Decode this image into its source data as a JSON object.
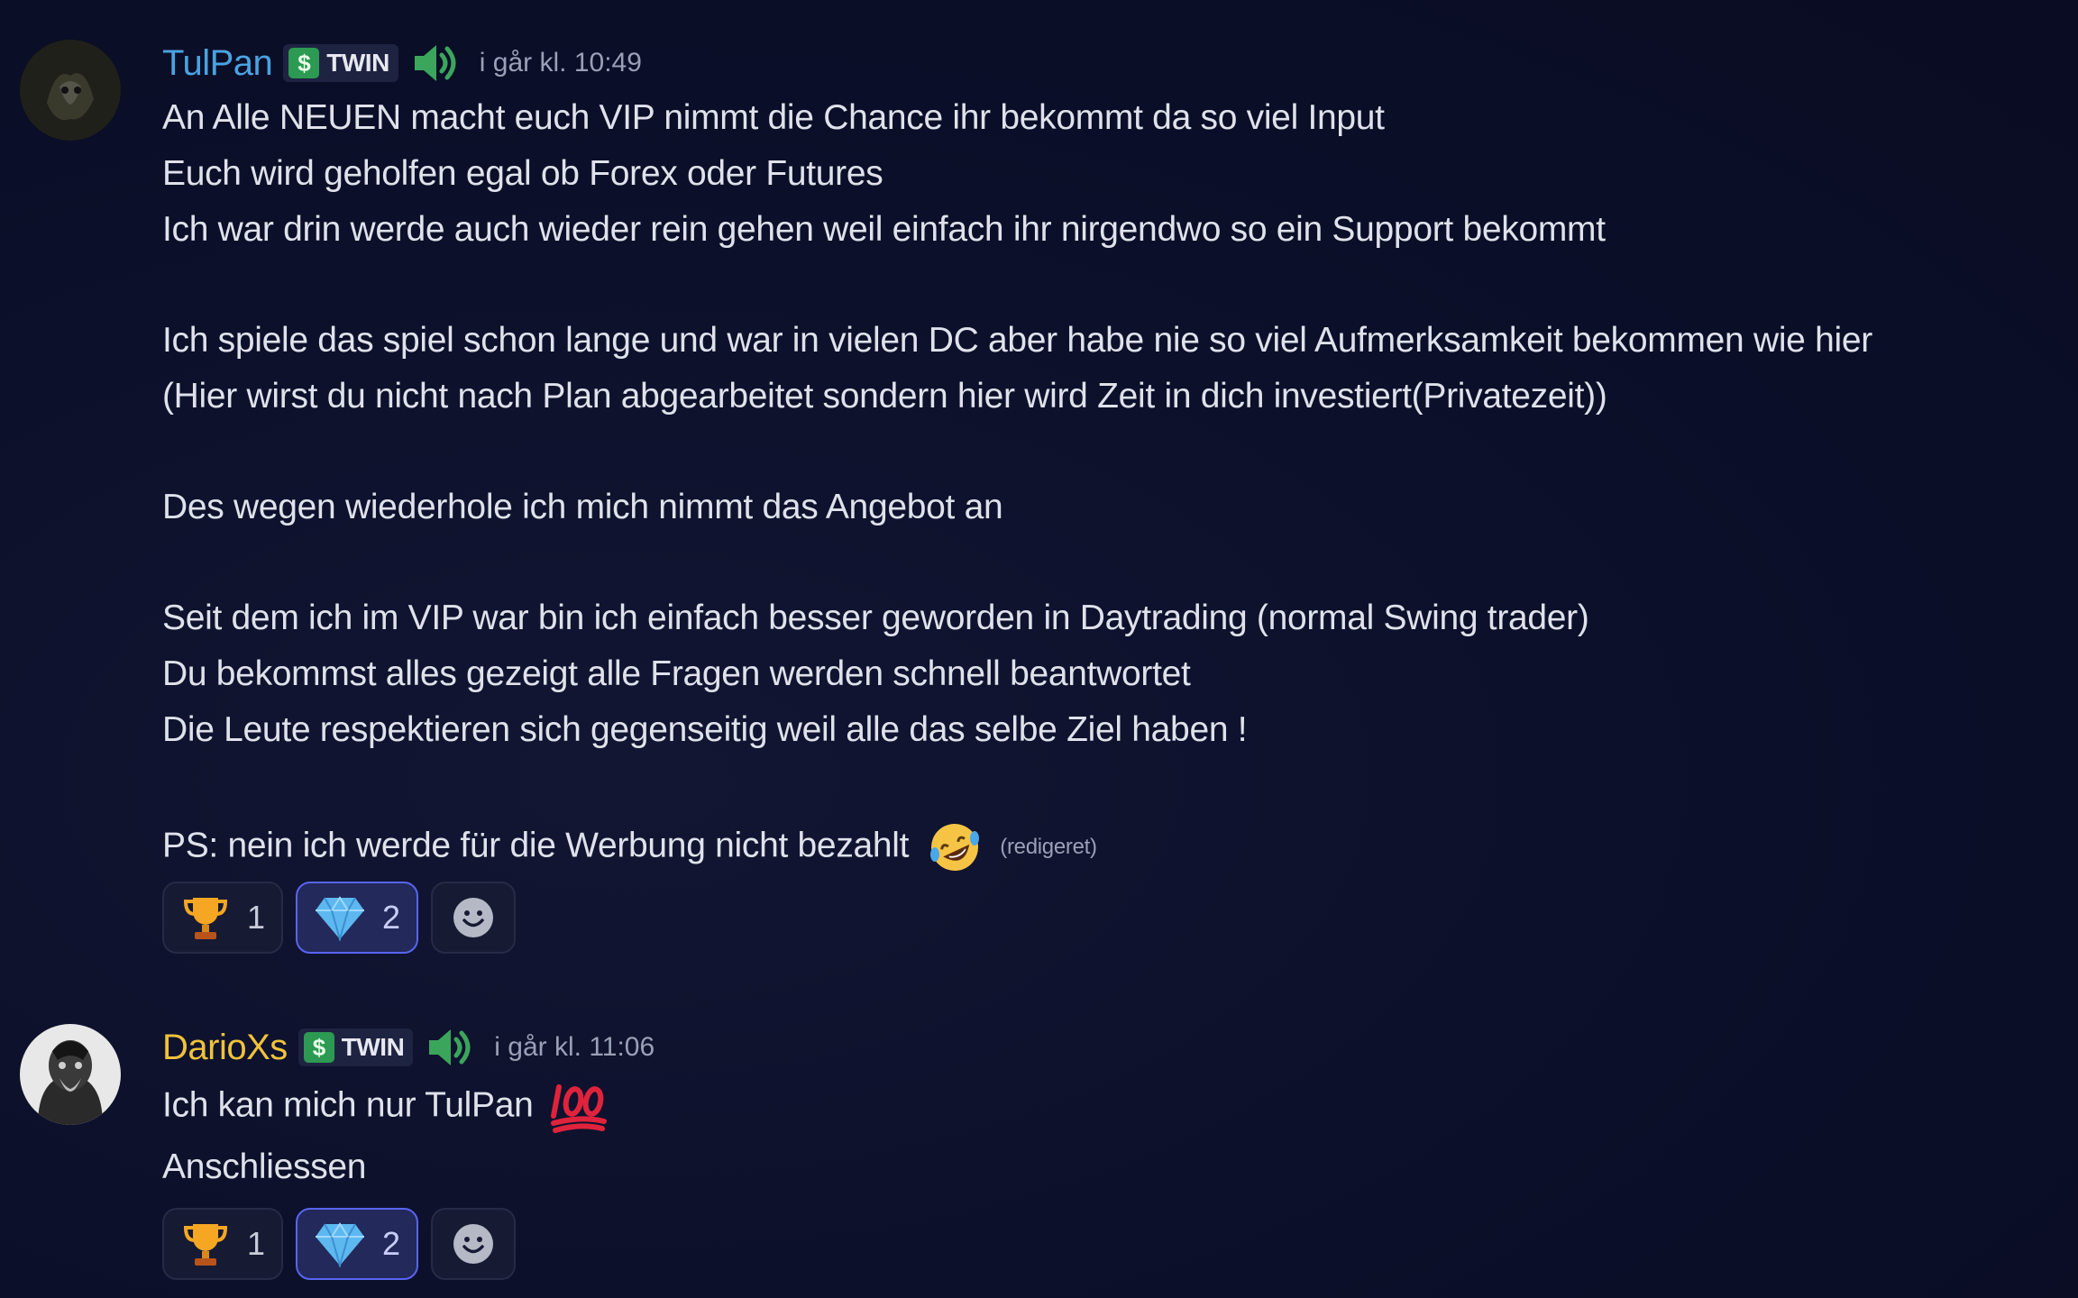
{
  "messages": [
    {
      "author": "TulPan",
      "author_color": "#4aa3e0",
      "tag": "TWIN",
      "timestamp": "i går kl. 10:49",
      "lines": [
        "An Alle NEUEN macht euch VIP nimmt die Chance ihr bekommt da so viel Input",
        "Euch wird geholfen egal ob Forex oder Futures",
        "Ich war drin werde auch wieder rein gehen weil einfach ihr nirgendwo so ein Support bekommt",
        "Ich spiele das spiel schon lange und war in vielen DC aber habe nie so viel Aufmerksamkeit bekommen wie hier",
        "(Hier wirst du nicht nach Plan abgearbeitet sondern hier wird Zeit in dich investiert(Privatezeit))",
        "Des wegen wiederhole ich mich nimmt das Angebot an",
        "Seit dem ich im VIP war bin ich einfach besser geworden in Daytrading (normal Swing trader)",
        "Du bekommst alles gezeigt alle Fragen werden schnell beantwortet",
        "Die Leute respektieren sich gegenseitig weil alle das selbe Ziel haben !",
        "PS: nein ich werde für die Werbung nicht bezahlt"
      ],
      "edited": "(redigeret)",
      "reactions": [
        {
          "emoji": "trophy-icon",
          "count": "1"
        },
        {
          "emoji": "gem-icon",
          "count": "2"
        }
      ]
    },
    {
      "author": "DarioXs",
      "author_color": "#f0c23a",
      "tag": "TWIN",
      "timestamp": "i går kl. 11:06",
      "lines": [
        "Ich kan mich nur TulPan",
        "Anschliessen"
      ],
      "reactions": [
        {
          "emoji": "trophy-icon",
          "count": "1"
        },
        {
          "emoji": "gem-icon",
          "count": "2"
        }
      ]
    }
  ]
}
